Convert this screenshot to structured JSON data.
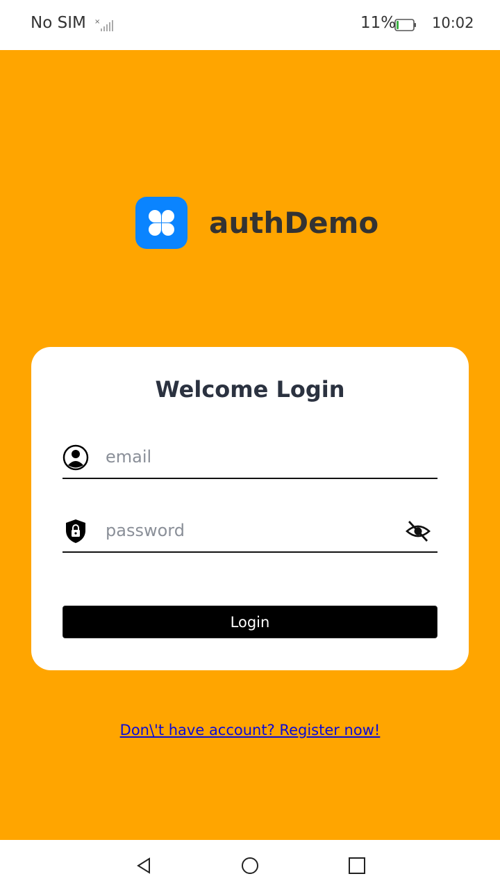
{
  "status_bar": {
    "carrier": "No SIM",
    "battery_percent": "11%",
    "time": "10:02"
  },
  "app": {
    "name": "authDemo",
    "icon": "clover-app-icon"
  },
  "login_card": {
    "title": "Welcome Login",
    "email": {
      "placeholder": "email",
      "value": "",
      "icon": "user-circle-icon"
    },
    "password": {
      "placeholder": "password",
      "value": "",
      "icon": "shield-lock-icon",
      "toggle_icon": "eye-off-icon"
    },
    "login_label": "Login"
  },
  "register_link": "Don\\'t have account? Register now!",
  "nav_bar": {
    "back_icon": "back-triangle-icon",
    "home_icon": "home-circle-icon",
    "recent_icon": "recent-square-icon"
  },
  "colors": {
    "background": "#FFA500",
    "app_icon": "#0A84FF",
    "card": "#FFFFFF",
    "button": "#000000",
    "link": "#0A0AD6"
  }
}
